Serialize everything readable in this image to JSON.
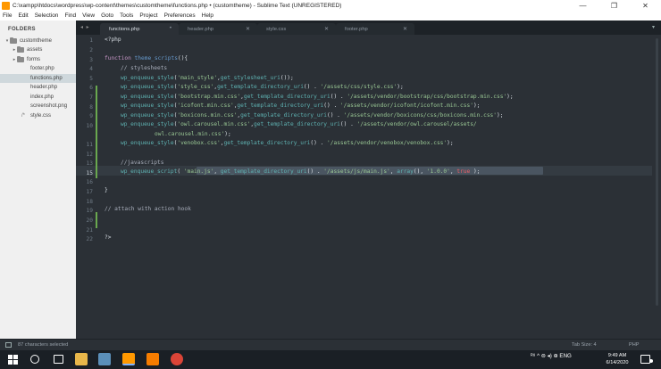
{
  "window": {
    "title": "C:\\xampp\\htdocs\\wordpress\\wp-content\\themes\\customtheme\\functions.php • (customtheme) - Sublime Text (UNREGISTERED)",
    "controls": [
      "—",
      "❐",
      "✕"
    ]
  },
  "menu": [
    "File",
    "Edit",
    "Selection",
    "Find",
    "View",
    "Goto",
    "Tools",
    "Project",
    "Preferences",
    "Help"
  ],
  "sidebar": {
    "heading": "FOLDERS",
    "root": "customtheme",
    "items": [
      {
        "label": "assets",
        "type": "folder"
      },
      {
        "label": "forms",
        "type": "folder"
      },
      {
        "label": "footer.php",
        "type": "file"
      },
      {
        "label": "functions.php",
        "type": "file",
        "selected": true
      },
      {
        "label": "header.php",
        "type": "file"
      },
      {
        "label": "index.php",
        "type": "file"
      },
      {
        "label": "screenshot.png",
        "type": "file"
      },
      {
        "label": "style.css",
        "type": "file",
        "prefix": "/*"
      }
    ]
  },
  "tabs": {
    "nav": "◂ ▸",
    "items": [
      {
        "label": "functions.php",
        "active": true,
        "close": "•"
      },
      {
        "label": "header.php",
        "active": false,
        "close": "✕"
      },
      {
        "label": "style.css",
        "active": false,
        "close": "✕"
      },
      {
        "label": "footer.php",
        "active": false,
        "close": "✕"
      }
    ],
    "dropdown": "▾"
  },
  "editor": {
    "line_numbers": [
      "1",
      "2",
      "3",
      "4",
      "5",
      "6",
      "7",
      "8",
      "9",
      "10",
      "",
      "11",
      "12",
      "13",
      "14",
      "15",
      "16",
      "17",
      "18",
      "19",
      "20",
      "21",
      "22"
    ],
    "active_line": "15",
    "code": {
      "l1": "<?php",
      "l3a": "function",
      "l3b": "theme_scripts",
      "l3c": "(){",
      "l4": "// stylesheets",
      "l5": [
        [
          "fc",
          "wp_enqueue_style"
        ],
        [
          "ph",
          "("
        ],
        [
          "str",
          "'main_style'"
        ],
        [
          "ph",
          ","
        ],
        [
          "fc",
          "get_stylesheet_uri"
        ],
        [
          "ph",
          "());"
        ]
      ],
      "l6": [
        [
          "fc",
          "wp_enqueue_style"
        ],
        [
          "ph",
          "("
        ],
        [
          "str",
          "'style_css'"
        ],
        [
          "ph",
          ","
        ],
        [
          "fc",
          "get_template_directory_uri"
        ],
        [
          "ph",
          "() . "
        ],
        [
          "str",
          "'/assets/css/style.css'"
        ],
        [
          "ph",
          ");"
        ]
      ],
      "l7": [
        [
          "fc",
          "wp_enqueue_style"
        ],
        [
          "ph",
          "("
        ],
        [
          "str",
          "'bootstrap.min.css'"
        ],
        [
          "ph",
          ","
        ],
        [
          "fc",
          "get_template_directory_uri"
        ],
        [
          "ph",
          "() . "
        ],
        [
          "str",
          "'/assets/vendor/bootstrap/css/bootstrap.min.css'"
        ],
        [
          "ph",
          ");"
        ]
      ],
      "l8": [
        [
          "fc",
          "wp_enqueue_style"
        ],
        [
          "ph",
          "("
        ],
        [
          "str",
          "'icofont.min.css'"
        ],
        [
          "ph",
          ","
        ],
        [
          "fc",
          "get_template_directory_uri"
        ],
        [
          "ph",
          "() . "
        ],
        [
          "str",
          "'/assets/vendor/icofont/icofont.min.css'"
        ],
        [
          "ph",
          ");"
        ]
      ],
      "l9": [
        [
          "fc",
          "wp_enqueue_style"
        ],
        [
          "ph",
          "("
        ],
        [
          "str",
          "'boxicons.min.css'"
        ],
        [
          "ph",
          ","
        ],
        [
          "fc",
          "get_template_directory_uri"
        ],
        [
          "ph",
          "() . "
        ],
        [
          "str",
          "'/assets/vendor/boxicons/css/boxicons.min.css'"
        ],
        [
          "ph",
          ");"
        ]
      ],
      "l10": [
        [
          "fc",
          "wp_enqueue_style"
        ],
        [
          "ph",
          "("
        ],
        [
          "str",
          "'owl.carousel.min.css'"
        ],
        [
          "ph",
          ","
        ],
        [
          "fc",
          "get_template_directory_uri"
        ],
        [
          "ph",
          "() . "
        ],
        [
          "str",
          "'/assets/vendor/owl.carousel/assets/"
        ]
      ],
      "l10b": [
        [
          "str",
          "owl.carousel.min.css'"
        ],
        [
          "ph",
          ");"
        ]
      ],
      "l11": [
        [
          "fc",
          "wp_enqueue_style"
        ],
        [
          "ph",
          "("
        ],
        [
          "str",
          "'venobox.css'"
        ],
        [
          "ph",
          ","
        ],
        [
          "fc",
          "get_template_directory_uri"
        ],
        [
          "ph",
          "() . "
        ],
        [
          "str",
          "'/assets/vendor/venobox/venobox.css'"
        ],
        [
          "ph",
          ");"
        ]
      ],
      "l14": "//javascripts",
      "l15": [
        [
          "fc",
          "wp_enqueue_script"
        ],
        [
          "ph",
          "( "
        ],
        [
          "str",
          "'main.js'"
        ],
        [
          "ph",
          ", "
        ],
        [
          "fc",
          "get_template_directory_uri"
        ],
        [
          "ph",
          "() . "
        ],
        [
          "str",
          "'/assets/js/main.js'"
        ],
        [
          "ph",
          ", "
        ],
        [
          "fc",
          "array"
        ],
        [
          "ph",
          "(), "
        ],
        [
          "str",
          "'1.0.0'"
        ],
        [
          "ph",
          ", "
        ],
        [
          "tr",
          "true"
        ],
        [
          "ph",
          " );"
        ]
      ],
      "l17": "}",
      "l19": "// attach with action hook",
      "l22": "?>"
    }
  },
  "status": {
    "left": "87 characters selected",
    "tab_size": "Tab Size: 4",
    "syntax": "PHP"
  },
  "taskbar": {
    "tray_text": "ᴿ⁸  ^  ⊜  ◂)  ⊕  ENG",
    "time": "9:49 AM",
    "date": "6/14/2020"
  },
  "colors": {
    "editor_bg": "#2b3036",
    "keyword": "#c594c5",
    "function": "#5fb3b3",
    "string": "#99c794",
    "comment": "#a7adba",
    "boolean": "#ec5f67",
    "modified_marker": "#6aa84f"
  }
}
